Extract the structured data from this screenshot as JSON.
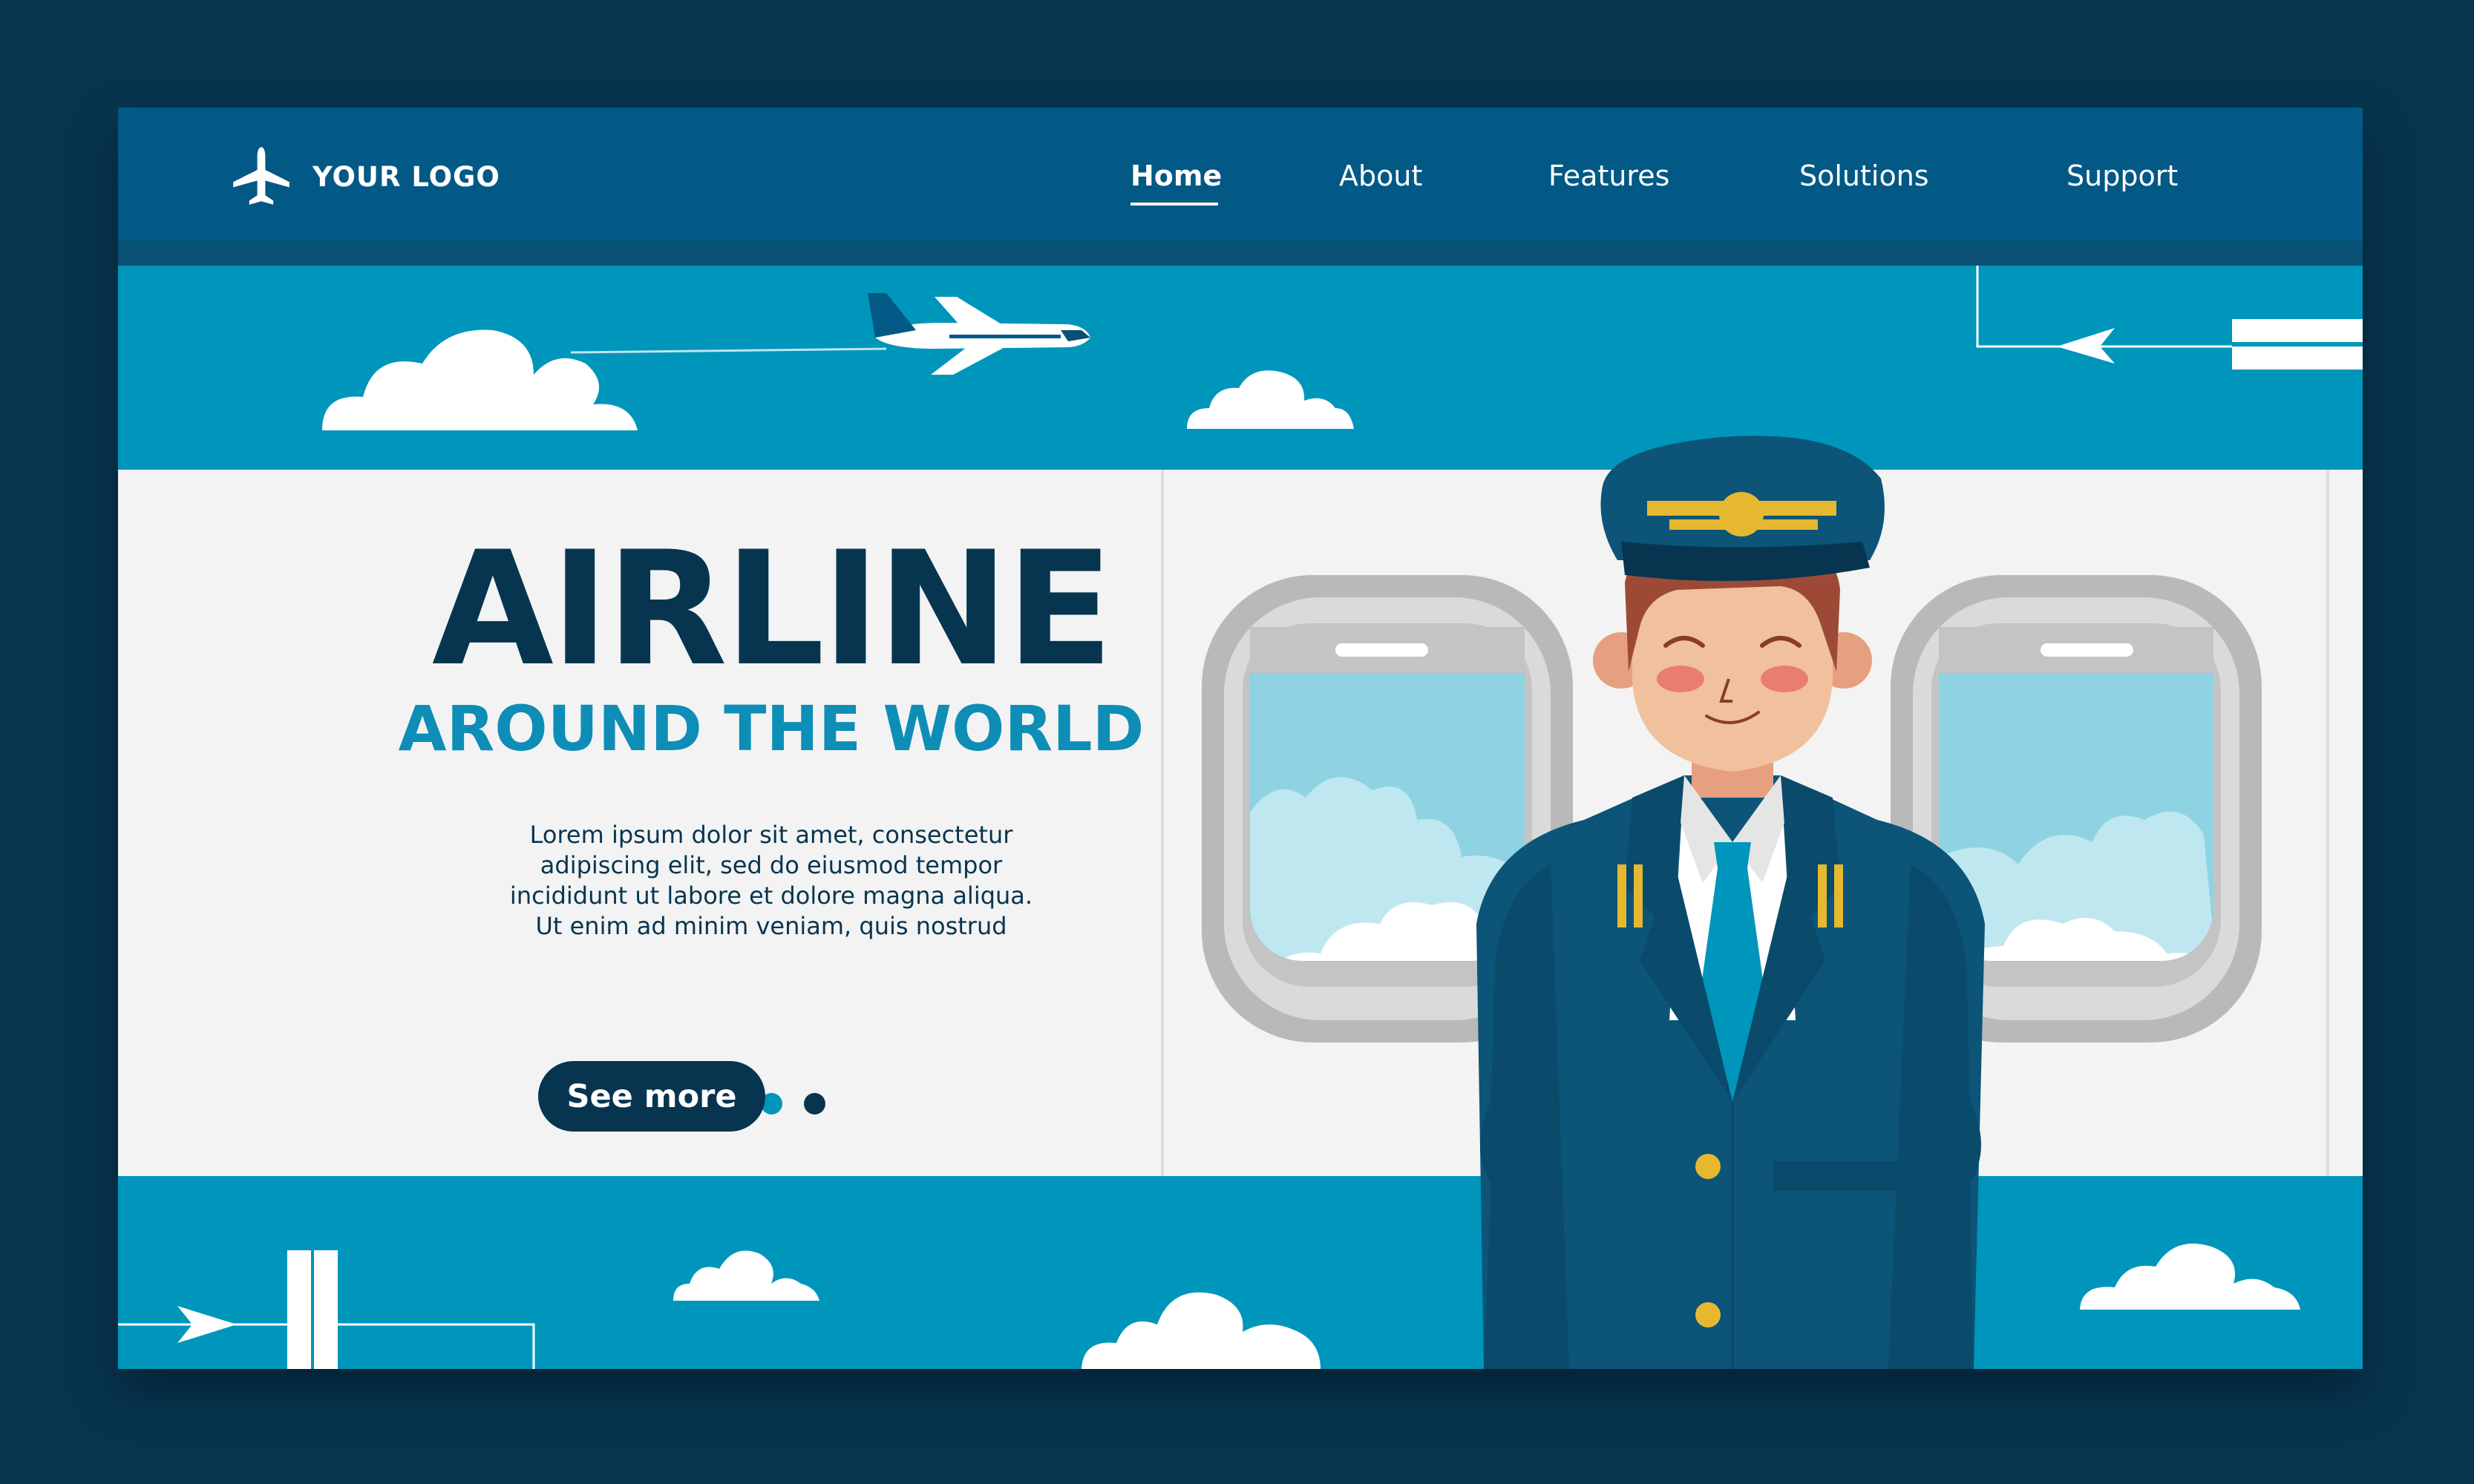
{
  "brand": {
    "logo_text": "YOUR LOGO",
    "logo_icon": "airplane-icon"
  },
  "nav": {
    "items": [
      {
        "label": "Home",
        "active": true
      },
      {
        "label": "About",
        "active": false
      },
      {
        "label": "Features",
        "active": false
      },
      {
        "label": "Solutions",
        "active": false
      },
      {
        "label": "Support",
        "active": false
      }
    ]
  },
  "hero": {
    "title": "AIRLINE",
    "subtitle": "AROUND THE WORLD",
    "body_lines": [
      "Lorem ipsum dolor sit amet, consectetur",
      "adipiscing elit, sed do eiusmod tempor",
      "incididunt ut labore et dolore magna aliqua.",
      "Ut enim ad minim veniam, quis nostrud"
    ],
    "carousel": {
      "total": 3,
      "active_index": 1
    },
    "cta_label": "See more"
  },
  "colors": {
    "page_bg": "#073550",
    "navbar": "#035985",
    "sky": "#0096bb",
    "cabin": "#f3f3f3",
    "title": "#073550",
    "subtitle": "#0e8db7",
    "uniform": "#0c5478",
    "gold": "#e6b830"
  }
}
